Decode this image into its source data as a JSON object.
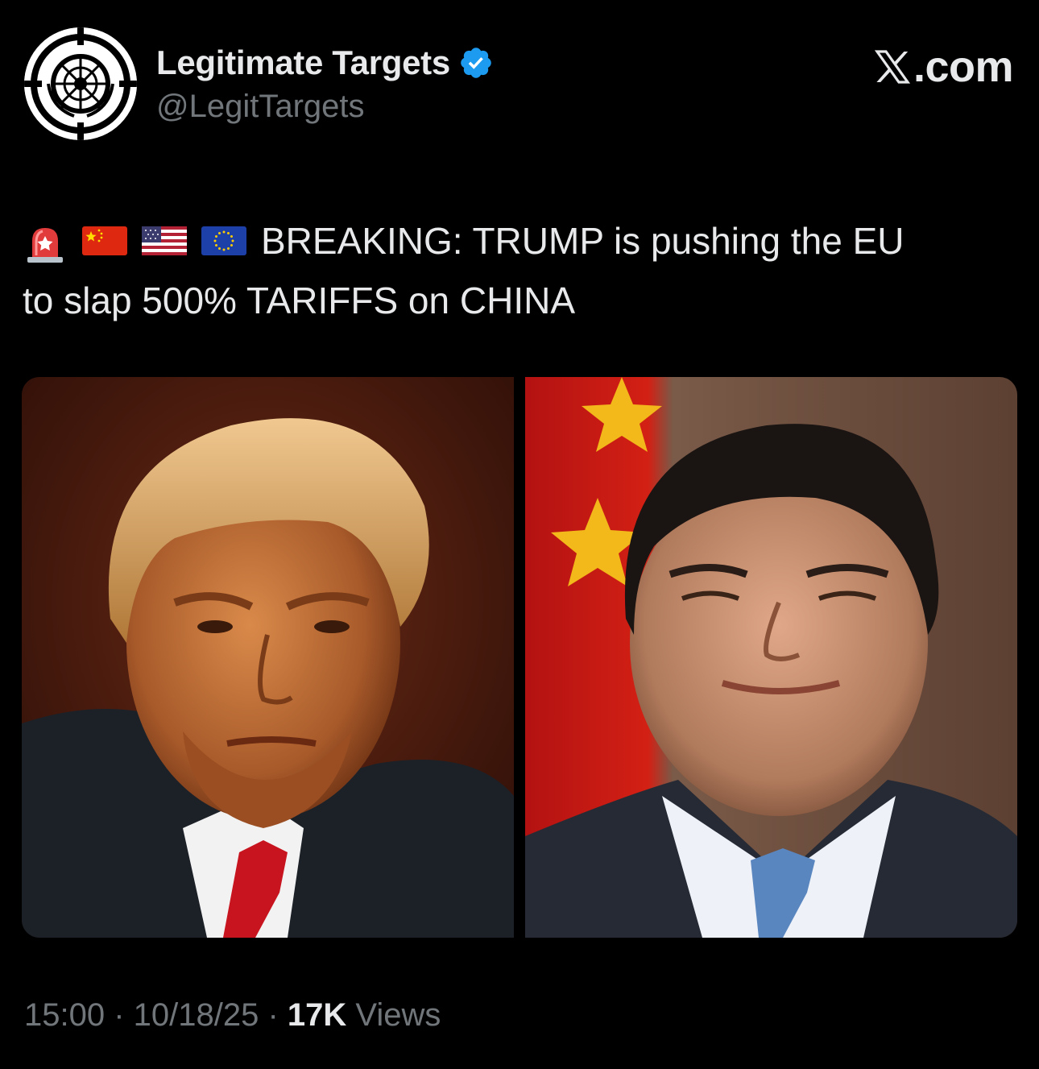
{
  "author": {
    "display_name": "Legitimate Targets",
    "handle": "@LegitTargets",
    "verified": true,
    "avatar_icon": "crosshair-un-emblem-icon"
  },
  "brand": {
    "label": ".com",
    "logo_icon": "x-logo-icon"
  },
  "tweet": {
    "emojis": [
      "rotating-light-emoji",
      "china-flag-emoji",
      "usa-flag-emoji",
      "eu-flag-emoji"
    ],
    "text_line1": "BREAKING: TRUMP is pushing the EU",
    "text_line2": "to slap 500% TARIFFS on CHINA"
  },
  "media": {
    "images": [
      "portrait-of-man-in-suit-with-red-tie",
      "portrait-of-man-in-front-of-chinese-flag"
    ]
  },
  "meta": {
    "time": "15:00",
    "separator": " · ",
    "date": "10/18/25",
    "views_count": "17K",
    "views_label": " Views"
  },
  "colors": {
    "background": "#000000",
    "text_primary": "#e7e9ea",
    "text_secondary": "#71767b",
    "verified_blue": "#1d9bf0"
  }
}
